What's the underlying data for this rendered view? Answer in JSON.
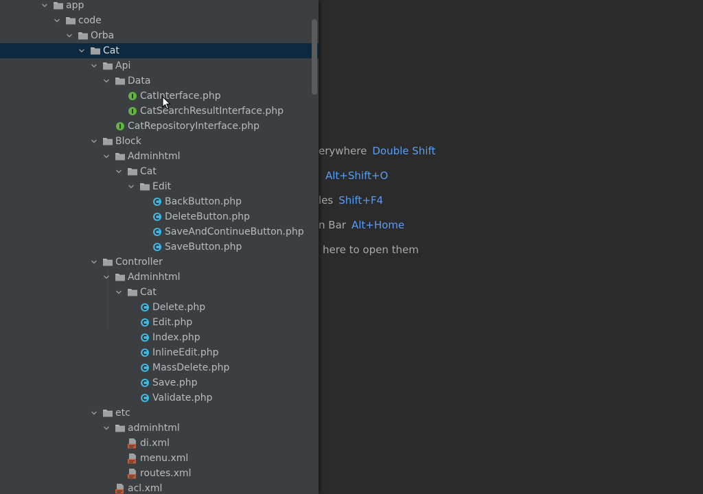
{
  "colors": {
    "panel_bg": "#3c3f41",
    "editor_bg": "#2b2b2b",
    "selection": "#0d293e",
    "text": "#bbbbbb",
    "shortcut": "#589df6",
    "interface_icon": "#62b543",
    "class_icon": "#40b6e0",
    "xml_icon": "#c55b32"
  },
  "project_tree": [
    {
      "label": "app",
      "type": "folder",
      "depth": 0,
      "expanded": true
    },
    {
      "label": "code",
      "type": "folder",
      "depth": 1,
      "expanded": true
    },
    {
      "label": "Orba",
      "type": "folder",
      "depth": 2,
      "expanded": true
    },
    {
      "label": "Cat",
      "type": "folder",
      "depth": 3,
      "expanded": true,
      "selected": true
    },
    {
      "label": "Api",
      "type": "folder",
      "depth": 4,
      "expanded": true
    },
    {
      "label": "Data",
      "type": "folder",
      "depth": 5,
      "expanded": true
    },
    {
      "label": "CatInterface.php",
      "type": "interface",
      "depth": 6
    },
    {
      "label": "CatSearchResultInterface.php",
      "type": "interface",
      "depth": 6
    },
    {
      "label": "CatRepositoryInterface.php",
      "type": "interface",
      "depth": 5
    },
    {
      "label": "Block",
      "type": "folder",
      "depth": 4,
      "expanded": true
    },
    {
      "label": "Adminhtml",
      "type": "folder",
      "depth": 5,
      "expanded": true
    },
    {
      "label": "Cat",
      "type": "folder",
      "depth": 6,
      "expanded": true
    },
    {
      "label": "Edit",
      "type": "folder",
      "depth": 7,
      "expanded": true
    },
    {
      "label": "BackButton.php",
      "type": "class",
      "depth": 8
    },
    {
      "label": "DeleteButton.php",
      "type": "class",
      "depth": 8
    },
    {
      "label": "SaveAndContinueButton.php",
      "type": "class",
      "depth": 8
    },
    {
      "label": "SaveButton.php",
      "type": "class",
      "depth": 8
    },
    {
      "label": "Controller",
      "type": "folder",
      "depth": 4,
      "expanded": true
    },
    {
      "label": "Adminhtml",
      "type": "folder",
      "depth": 5,
      "expanded": true
    },
    {
      "label": "Cat",
      "type": "folder",
      "depth": 6,
      "expanded": true
    },
    {
      "label": "Delete.php",
      "type": "class",
      "depth": 7
    },
    {
      "label": "Edit.php",
      "type": "class",
      "depth": 7
    },
    {
      "label": "Index.php",
      "type": "class",
      "depth": 7
    },
    {
      "label": "InlineEdit.php",
      "type": "class",
      "depth": 7
    },
    {
      "label": "MassDelete.php",
      "type": "class",
      "depth": 7
    },
    {
      "label": "Save.php",
      "type": "class",
      "depth": 7
    },
    {
      "label": "Validate.php",
      "type": "class",
      "depth": 7
    },
    {
      "label": "etc",
      "type": "folder",
      "depth": 4,
      "expanded": true
    },
    {
      "label": "adminhtml",
      "type": "folder",
      "depth": 5,
      "expanded": true
    },
    {
      "label": "di.xml",
      "type": "xml",
      "depth": 6
    },
    {
      "label": "menu.xml",
      "type": "xml",
      "depth": 6
    },
    {
      "label": "routes.xml",
      "type": "xml",
      "depth": 6
    },
    {
      "label": "acl.xml",
      "type": "xml",
      "depth": 5
    }
  ],
  "editor_hints": [
    {
      "text": "erywhere",
      "shortcut": "Double Shift"
    },
    {
      "text": "",
      "shortcut": "Alt+Shift+O"
    },
    {
      "text": "les",
      "shortcut": "Shift+F4"
    },
    {
      "text": "n Bar",
      "shortcut": "Alt+Home"
    },
    {
      "text": "here to open them",
      "shortcut": ""
    }
  ]
}
